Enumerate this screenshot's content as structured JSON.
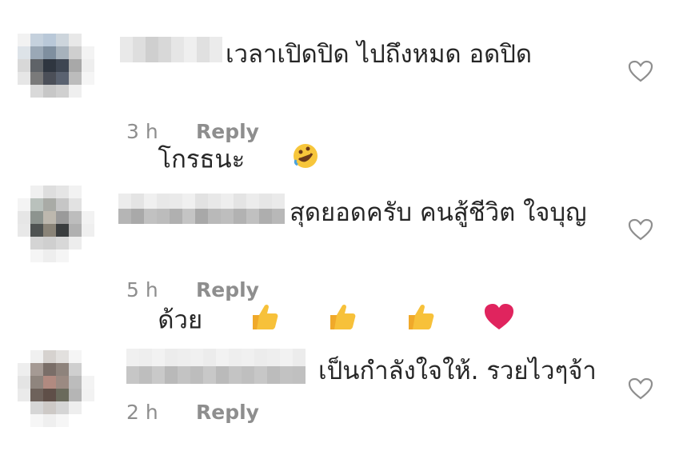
{
  "comments": [
    {
      "line1": "เวลาเปิดปิด ไปถึงหมด อดปิด",
      "line2": "โกรธนะ",
      "emoji": [
        "rolling-on-floor-laughing-icon"
      ],
      "time": "3 h",
      "reply": "Reply",
      "like_icon": "heart-outline-icon"
    },
    {
      "line1": "สุดยอดครับ คนสู้ชีวิต ใจบุญ",
      "line2": "ด้วย",
      "emoji": [
        "thumbs-up-icon",
        "thumbs-up-icon",
        "thumbs-up-icon",
        "red-heart-icon"
      ],
      "time": "5 h",
      "reply": "Reply",
      "like_icon": "heart-outline-icon"
    },
    {
      "line1": "เป็นกำลังใจให้. รวยไวๆจ้า",
      "time": "2 h",
      "reply": "Reply",
      "like_icon": "heart-outline-icon"
    }
  ],
  "colors": {
    "text": "#262626",
    "meta": "#8e8e8e",
    "thumbs": "#f7b731",
    "heart": "#e0245e"
  }
}
